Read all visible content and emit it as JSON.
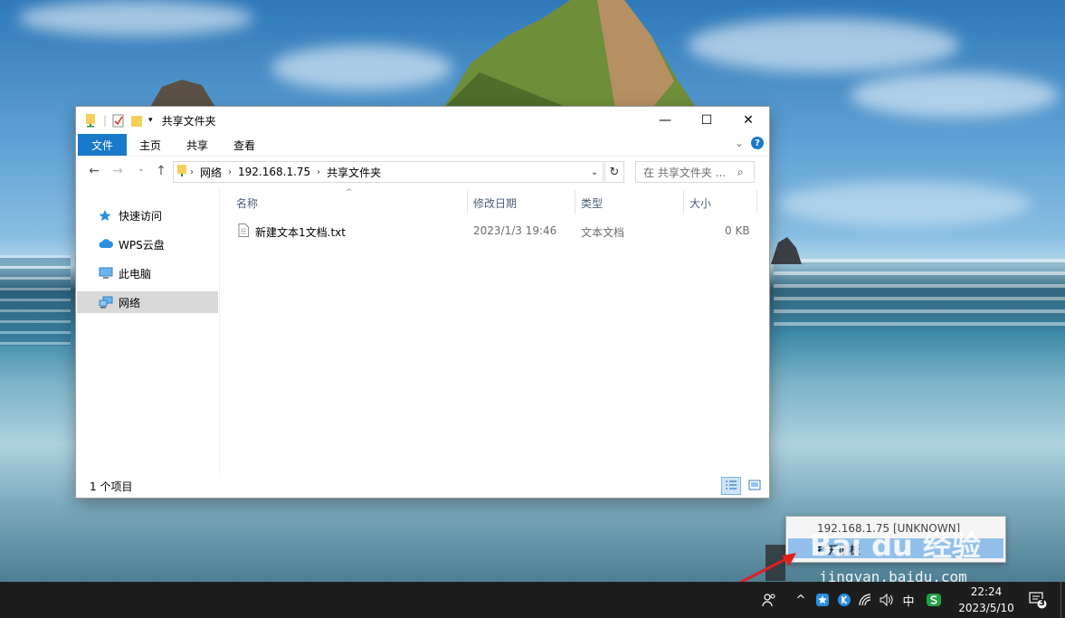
{
  "window": {
    "title": "共享文件夹",
    "minimize": "—",
    "maximize": "☐",
    "close": "✕"
  },
  "ribbon": {
    "tabs": [
      "文件",
      "主页",
      "共享",
      "查看"
    ],
    "expand": "⌄",
    "help": "?"
  },
  "address": {
    "crumbs": [
      "网络",
      "192.168.1.75",
      "共享文件夹"
    ],
    "search_placeholder": "在 共享文件夹 ..."
  },
  "nav_pane": {
    "items": [
      {
        "label": "快速访问",
        "icon": "star-icon"
      },
      {
        "label": "WPS云盘",
        "icon": "cloud-icon"
      },
      {
        "label": "此电脑",
        "icon": "computer-icon"
      },
      {
        "label": "网络",
        "icon": "network-icon",
        "selected": true
      }
    ]
  },
  "columns": [
    "名称",
    "修改日期",
    "类型",
    "大小"
  ],
  "files": [
    {
      "name": "新建文本1文档.txt",
      "modified": "2023/1/3 19:46",
      "type": "文本文档",
      "size": "0 KB"
    }
  ],
  "status": {
    "count": "1 个项目"
  },
  "tray_popup": {
    "line1": "192.168.1.75 [UNKNOWN]",
    "line2": "打开面板"
  },
  "watermark": {
    "brand": "Bai du 经验",
    "url": "jingyan.baidu.com"
  },
  "taskbar": {
    "ime": "中",
    "time": "22:24",
    "date": "2023/5/10",
    "notification_count": "3"
  },
  "colors": {
    "accent": "#1979ca",
    "selection": "#d9d9d9",
    "taskbar": "#1d1d1d"
  }
}
